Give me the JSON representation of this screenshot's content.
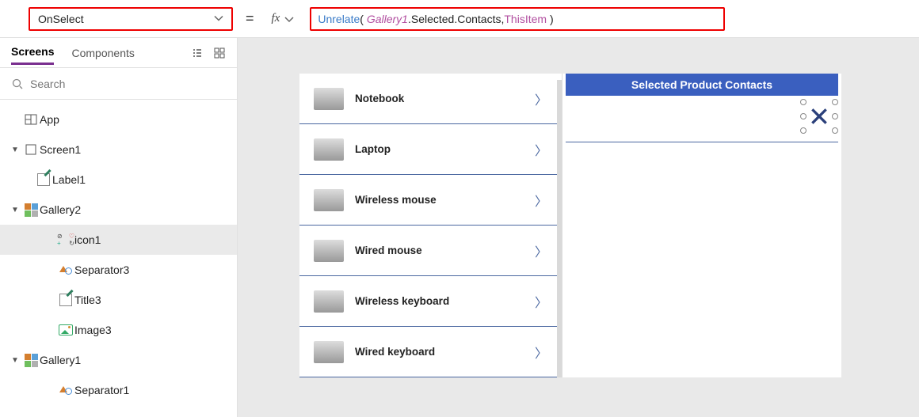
{
  "property": {
    "name": "OnSelect"
  },
  "formula": {
    "fn": "Unrelate",
    "obj": "Gallery1",
    "path": ".Selected.Contacts, ",
    "this": "ThisItem"
  },
  "tabs": {
    "screens": "Screens",
    "components": "Components"
  },
  "search": {
    "placeholder": "Search"
  },
  "tree": {
    "app": "App",
    "screen1": "Screen1",
    "label1": "Label1",
    "gallery2": "Gallery2",
    "icon1": "icon1",
    "separator3": "Separator3",
    "title3": "Title3",
    "image3": "Image3",
    "gallery1": "Gallery1",
    "separator1": "Separator1"
  },
  "products": [
    "Notebook",
    "Laptop",
    "Wireless mouse",
    "Wired mouse",
    "Wireless keyboard",
    "Wired keyboard"
  ],
  "header": {
    "title": "Selected Product Contacts"
  }
}
